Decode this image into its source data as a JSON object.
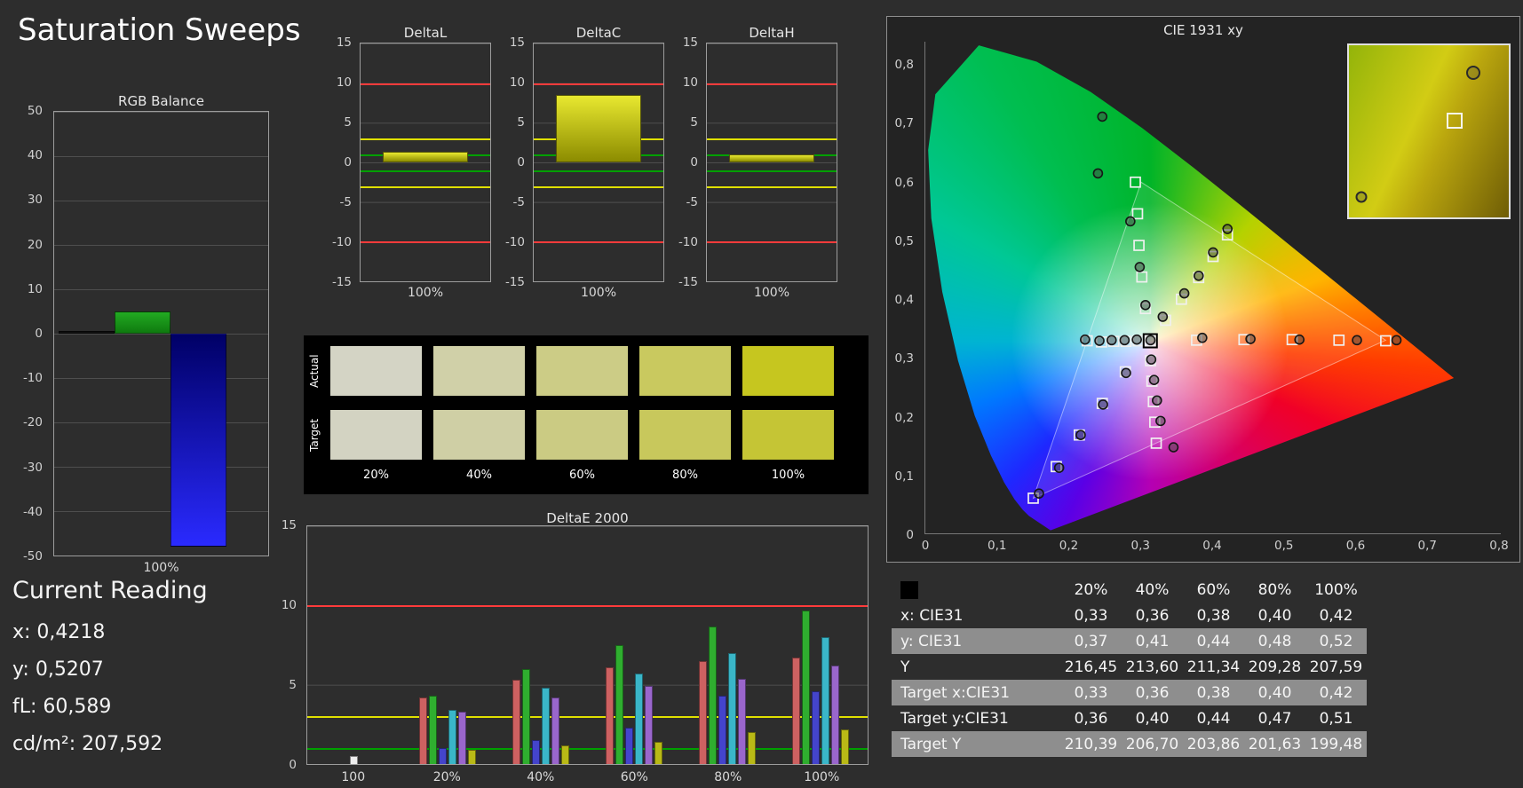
{
  "title": "Saturation Sweeps",
  "current_reading": {
    "title": "Current Reading",
    "lines": [
      "x: 0,4218",
      "y: 0,5207",
      "fL: 60,589",
      "cd/m²: 207,592"
    ]
  },
  "rgb_balance": {
    "title": "RGB Balance",
    "x_label": "100%",
    "ymin": -50,
    "ymax": 50,
    "yticks": [
      "50",
      "40",
      "30",
      "20",
      "10",
      "0",
      "-10",
      "-20",
      "-30",
      "-40",
      "-50"
    ],
    "bars": [
      {
        "name": "red",
        "value": 0,
        "color": "#101010"
      },
      {
        "name": "green",
        "value": 5,
        "color": "linear-gradient(180deg,#22aa22,#0f7a0f)"
      },
      {
        "name": "blue",
        "value": -48,
        "color": "linear-gradient(180deg,#000066,#2a2aff)"
      }
    ]
  },
  "delta_charts": {
    "ymin": -15,
    "ymax": 15,
    "yticks": [
      "15",
      "10",
      "5",
      "0",
      "-5",
      "-10",
      "-15"
    ],
    "x_label": "100%",
    "ref_lines": [
      {
        "value": 10,
        "color": "#ff3b3b"
      },
      {
        "value": 3,
        "color": "#e0e000"
      },
      {
        "value": 1,
        "color": "#00a000"
      },
      {
        "value": -1,
        "color": "#00a000"
      },
      {
        "value": -3,
        "color": "#e0e000"
      },
      {
        "value": -10,
        "color": "#ff3b3b"
      }
    ],
    "charts": [
      {
        "title": "DeltaL",
        "value": 1.3
      },
      {
        "title": "DeltaC",
        "value": 8.5
      },
      {
        "title": "DeltaH",
        "value": 1.0
      }
    ]
  },
  "swatches": {
    "row_labels": [
      "Actual",
      "Target"
    ],
    "column_labels": [
      "20%",
      "40%",
      "60%",
      "80%",
      "100%"
    ],
    "actual": [
      "#d4d4c5",
      "#d0d0a8",
      "#cccc86",
      "#c9c95f",
      "#c6c61f"
    ],
    "target": [
      "#d3d3c2",
      "#cfcfa5",
      "#cbcb83",
      "#c8c85c",
      "#c5c535"
    ]
  },
  "deltae": {
    "title": "DeltaE 2000",
    "ymax": 15,
    "yticks": [
      "15",
      "10",
      "5",
      "0"
    ],
    "ref_lines": [
      {
        "value": 10,
        "color": "#ff3b3b"
      },
      {
        "value": 3,
        "color": "#e0e000"
      },
      {
        "value": 1,
        "color": "#00a000"
      }
    ],
    "series_colors": [
      "#cd6161",
      "#2fae2f",
      "#4444cc",
      "#3ab6c8",
      "#9a66cc",
      "#b9b916"
    ],
    "groups": [
      {
        "label": "100",
        "values": [
          0.5
        ],
        "colors": [
          "#ededed"
        ]
      },
      {
        "label": "20%",
        "values": [
          4.2,
          4.3,
          1.0,
          3.4,
          3.3,
          0.9
        ]
      },
      {
        "label": "40%",
        "values": [
          5.3,
          6.0,
          1.5,
          4.8,
          4.2,
          1.2
        ]
      },
      {
        "label": "60%",
        "values": [
          6.1,
          7.5,
          2.3,
          5.7,
          4.9,
          1.4
        ]
      },
      {
        "label": "80%",
        "values": [
          6.5,
          8.7,
          4.3,
          7.0,
          5.4,
          2.0
        ]
      },
      {
        "label": "100%",
        "values": [
          6.7,
          9.7,
          4.6,
          8.0,
          6.2,
          2.2
        ]
      }
    ]
  },
  "cie": {
    "title": "CIE 1931 xy",
    "xmax": 0.8,
    "ymax": 0.84,
    "x_ticks": [
      "0",
      "0,1",
      "0,2",
      "0,3",
      "0,4",
      "0,5",
      "0,6",
      "0,7",
      "0,8"
    ],
    "y_ticks": [
      "0,8",
      "0,7",
      "0,6",
      "0,5",
      "0,4",
      "0,3",
      "0,2",
      "0,1",
      "0"
    ],
    "triangle": [
      [
        0.64,
        0.33
      ],
      [
        0.3,
        0.6
      ],
      [
        0.15,
        0.06
      ]
    ],
    "white_point": [
      0.3127,
      0.329
    ],
    "highlight": [
      0.3127,
      0.329
    ],
    "targets": [
      [
        0.377,
        0.33
      ],
      [
        0.443,
        0.331
      ],
      [
        0.51,
        0.331
      ],
      [
        0.575,
        0.33
      ],
      [
        0.64,
        0.329
      ],
      [
        0.306,
        0.384
      ],
      [
        0.301,
        0.438
      ],
      [
        0.297,
        0.492
      ],
      [
        0.295,
        0.546
      ],
      [
        0.292,
        0.6
      ],
      [
        0.278,
        0.276
      ],
      [
        0.246,
        0.222
      ],
      [
        0.214,
        0.168
      ],
      [
        0.182,
        0.114
      ],
      [
        0.15,
        0.06
      ],
      [
        0.334,
        0.364
      ],
      [
        0.356,
        0.4
      ],
      [
        0.38,
        0.437
      ],
      [
        0.4,
        0.473
      ],
      [
        0.42,
        0.51
      ],
      [
        0.313,
        0.295
      ],
      [
        0.315,
        0.26
      ],
      [
        0.317,
        0.225
      ],
      [
        0.319,
        0.19
      ],
      [
        0.321,
        0.154
      ],
      [
        0.296,
        0.329
      ],
      [
        0.279,
        0.328
      ],
      [
        0.262,
        0.328
      ],
      [
        0.245,
        0.327
      ],
      [
        0.225,
        0.329
      ],
      [
        0.3127,
        0.329
      ]
    ],
    "measurements": [
      [
        0.385,
        0.334
      ],
      [
        0.452,
        0.332
      ],
      [
        0.52,
        0.331
      ],
      [
        0.6,
        0.33
      ],
      [
        0.655,
        0.33
      ],
      [
        0.306,
        0.39
      ],
      [
        0.298,
        0.455
      ],
      [
        0.285,
        0.533
      ],
      [
        0.24,
        0.615
      ],
      [
        0.246,
        0.712
      ],
      [
        0.279,
        0.274
      ],
      [
        0.247,
        0.22
      ],
      [
        0.216,
        0.168
      ],
      [
        0.186,
        0.112
      ],
      [
        0.158,
        0.068
      ],
      [
        0.33,
        0.37
      ],
      [
        0.36,
        0.41
      ],
      [
        0.38,
        0.44
      ],
      [
        0.4,
        0.48
      ],
      [
        0.42,
        0.52
      ],
      [
        0.314,
        0.297
      ],
      [
        0.318,
        0.262
      ],
      [
        0.322,
        0.227
      ],
      [
        0.327,
        0.192
      ],
      [
        0.345,
        0.147
      ],
      [
        0.294,
        0.331
      ],
      [
        0.277,
        0.33
      ],
      [
        0.259,
        0.33
      ],
      [
        0.242,
        0.329
      ],
      [
        0.222,
        0.331
      ],
      [
        0.313,
        0.33
      ]
    ],
    "inset_markers": {
      "circle": [
        0.78,
        0.16
      ],
      "square": [
        0.66,
        0.44
      ],
      "small_circle": [
        0.08,
        0.88
      ]
    }
  },
  "table": {
    "columns": [
      "20%",
      "40%",
      "60%",
      "80%",
      "100%"
    ],
    "rows": [
      {
        "label": "x: CIE31",
        "values": [
          "0,33",
          "0,36",
          "0,38",
          "0,40",
          "0,42"
        ]
      },
      {
        "label": "y: CIE31",
        "values": [
          "0,37",
          "0,41",
          "0,44",
          "0,48",
          "0,52"
        ]
      },
      {
        "label": "Y",
        "values": [
          "216,45",
          "213,60",
          "211,34",
          "209,28",
          "207,59"
        ]
      },
      {
        "label": "Target x:CIE31",
        "values": [
          "0,33",
          "0,36",
          "0,38",
          "0,40",
          "0,42"
        ]
      },
      {
        "label": "Target y:CIE31",
        "values": [
          "0,36",
          "0,40",
          "0,44",
          "0,47",
          "0,51"
        ]
      },
      {
        "label": "Target Y",
        "values": [
          "210,39",
          "206,70",
          "203,86",
          "201,63",
          "199,48"
        ]
      }
    ]
  }
}
